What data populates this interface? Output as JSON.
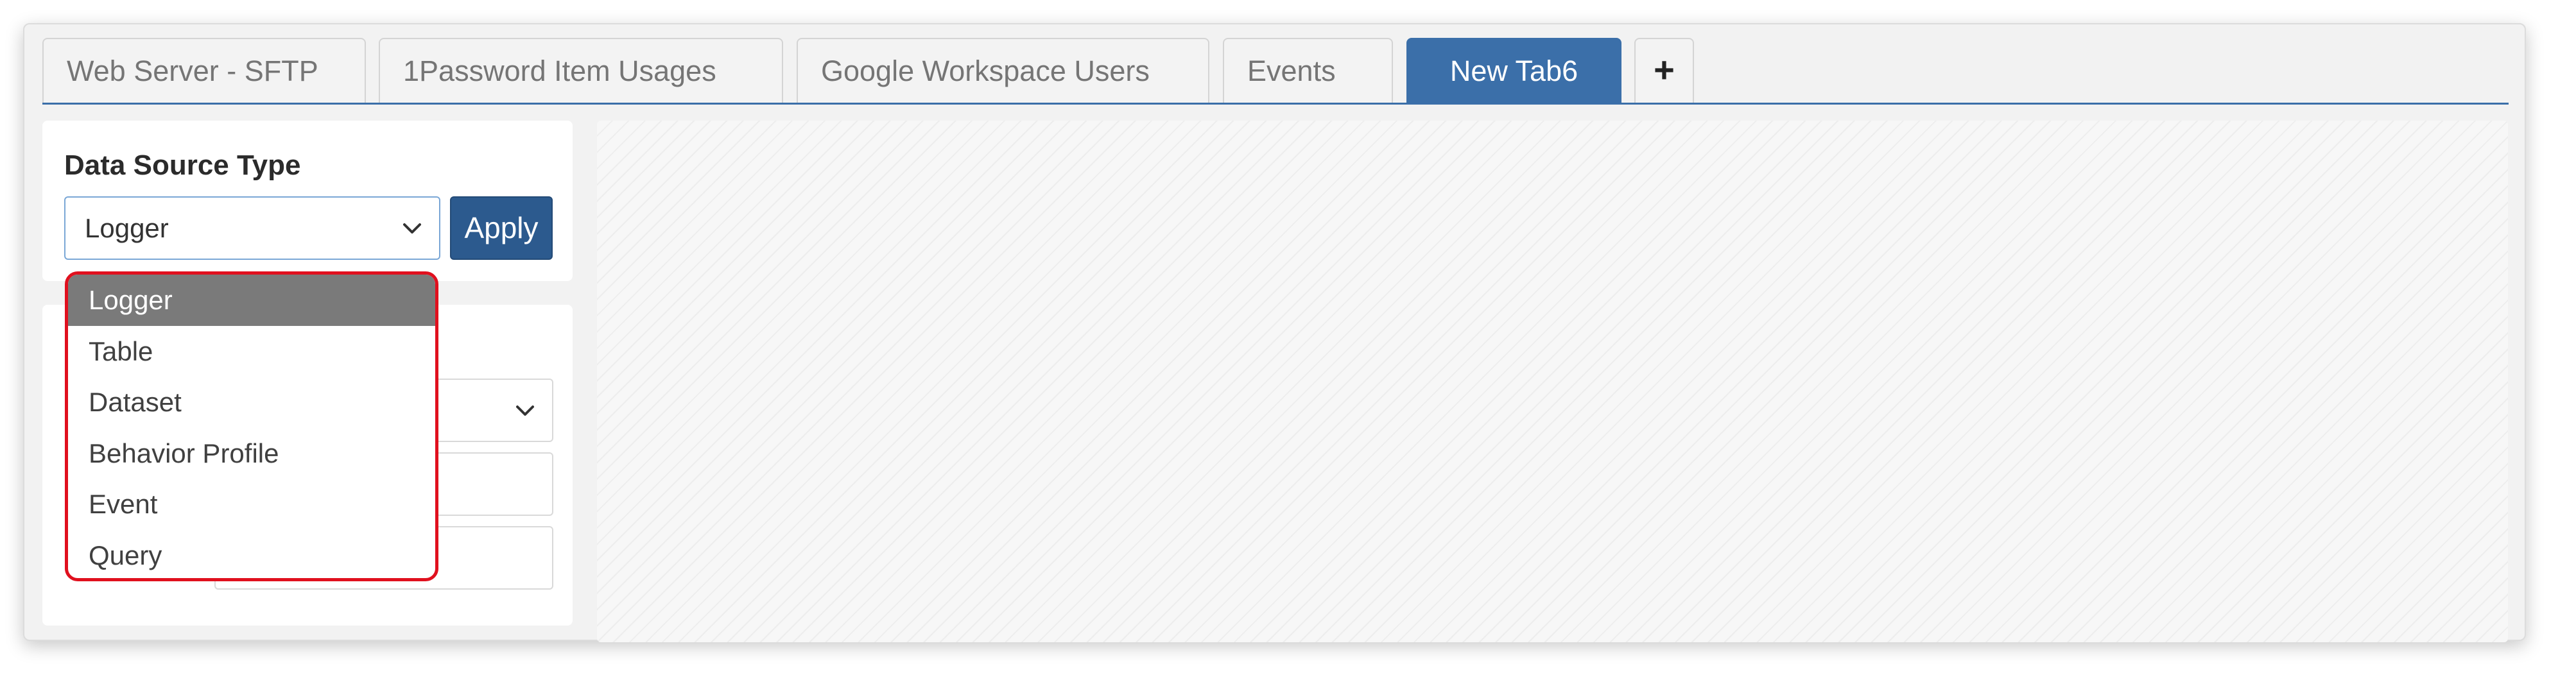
{
  "tabs": [
    {
      "label": "Web Server - SFTP"
    },
    {
      "label": "1Password Item Usages"
    },
    {
      "label": "Google Workspace Users"
    },
    {
      "label": "Events"
    },
    {
      "label": "New Tab6",
      "active": true
    }
  ],
  "add_tab_icon": "+",
  "data_source": {
    "title": "Data Source Type",
    "selected": "Logger",
    "apply_label": "Apply",
    "options": [
      "Logger",
      "Table",
      "Dataset",
      "Behavior Profile",
      "Event",
      "Query"
    ]
  },
  "icons": {
    "add": "plus-icon",
    "select_arrow": "chevron-down-icon"
  },
  "colors": {
    "accent": "#3b6fa9",
    "apply_button": "#2c5a8e",
    "dropdown_highlight": "#e0101e",
    "selected_option": "#7a7a7a"
  }
}
